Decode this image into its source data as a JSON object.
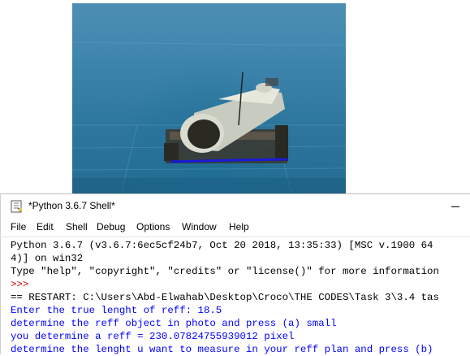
{
  "shell": {
    "title": "*Python 3.6.7 Shell*",
    "menu": [
      "File",
      "Edit",
      "Shell",
      "Debug",
      "Options",
      "Window",
      "Help"
    ],
    "console_lines": [
      {
        "text": "Python 3.6.7 (v3.6.7:6ec5cf24b7, Oct 20 2018, 13:35:33) [MSC v.1900 64",
        "color": "black"
      },
      {
        "text": "4)] on win32",
        "color": "black"
      },
      {
        "text": "Type \"help\", \"copyright\", \"credits\" or \"license()\" for more information",
        "color": "black"
      },
      {
        "text": ">>> ",
        "color": "red"
      },
      {
        "text": "== RESTART: C:\\Users\\Abd-Elwahab\\Desktop\\Croco\\THE CODES\\Task 3\\3.4 tas",
        "color": "black"
      },
      {
        "text": "Enter the true lenght of reff: 18.5",
        "color": "blue"
      },
      {
        "text": "determine the reff object in photo and press (a) small",
        "color": "blue"
      },
      {
        "text": "you determine a reff = 230.07824755939012 pixel",
        "color": "blue"
      },
      {
        "text": "determine the lenght u want to measure in your reff plan and press (b)",
        "color": "blue"
      }
    ]
  },
  "colors": {
    "prompt_red": "#c00000",
    "output_blue": "#0000ff",
    "measure_line": "#1a1ad8"
  },
  "icons": {
    "title": "idle-shell-icon"
  }
}
